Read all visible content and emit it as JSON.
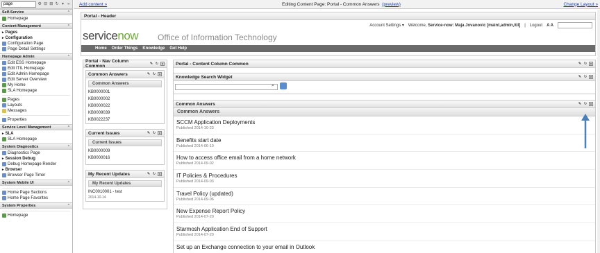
{
  "nav": {
    "search_value": "page",
    "sections": [
      {
        "title": "Self-Service",
        "items": [
          {
            "label": "Homepage",
            "bold": false,
            "color": "#5a9a4a"
          }
        ]
      },
      {
        "title": "Content Management",
        "items": [
          {
            "label": "Pages",
            "bold": true,
            "color": ""
          },
          {
            "label": "Configuration",
            "bold": true,
            "color": ""
          },
          {
            "label": "Configuration Page",
            "bold": false,
            "color": "#6b8ec8"
          },
          {
            "label": "Page Detail Settings",
            "bold": false,
            "color": "#6b8ec8"
          }
        ]
      },
      {
        "title": "Homepage Admin",
        "items": [
          {
            "label": "Edit ESS Homepage",
            "bold": false,
            "color": "#6b8ec8"
          },
          {
            "label": "Edit ITIL Homepage",
            "bold": false,
            "color": "#6b8ec8"
          },
          {
            "label": "Edit Admin Homepage",
            "bold": false,
            "color": "#6b8ec8"
          },
          {
            "label": "Edit Server Overview",
            "bold": false,
            "color": "#6b8ec8"
          },
          {
            "label": "My Home",
            "bold": false,
            "color": "#5a9a4a"
          },
          {
            "label": "SLA Homepage",
            "bold": false,
            "color": "#5a9a4a"
          },
          {
            "label": "",
            "bold": false,
            "color": "gap"
          },
          {
            "label": "Pages",
            "bold": false,
            "color": "#5a9a4a"
          },
          {
            "label": "Layouts",
            "bold": false,
            "color": "#6b8ec8"
          },
          {
            "label": "Messages",
            "bold": false,
            "color": "#d9c445"
          },
          {
            "label": "",
            "bold": false,
            "color": "gap"
          },
          {
            "label": "Properties",
            "bold": false,
            "color": "#6b8ec8"
          }
        ]
      },
      {
        "title": "Service Level Management",
        "items": [
          {
            "label": "SLA",
            "bold": true,
            "color": ""
          },
          {
            "label": "SLA Homepage",
            "bold": false,
            "color": "#5a9a4a"
          }
        ]
      },
      {
        "title": "System Diagnostics",
        "items": [
          {
            "label": "Diagnostics Page",
            "bold": false,
            "color": "#6b8ec8"
          },
          {
            "label": "Session Debug",
            "bold": true,
            "color": ""
          },
          {
            "label": "Debug Homepage Render",
            "bold": false,
            "color": "#6b8ec8"
          },
          {
            "label": "Browser",
            "bold": true,
            "color": ""
          },
          {
            "label": "Browser Page Timer",
            "bold": false,
            "color": "#6b8ec8"
          }
        ]
      },
      {
        "title": "System Mobile UI",
        "items": [
          {
            "label": "",
            "bold": false,
            "color": "gap"
          },
          {
            "label": "Home Page Sections",
            "bold": false,
            "color": "#6b8ec8"
          },
          {
            "label": "Home Page Favorites",
            "bold": false,
            "color": "#6b8ec8"
          }
        ]
      },
      {
        "title": "System Properties",
        "items": [
          {
            "label": "",
            "bold": false,
            "color": "gap"
          },
          {
            "label": "Homepage",
            "bold": false,
            "color": "#5a9a4a"
          }
        ]
      }
    ]
  },
  "topbar": {
    "add_content": "Add content »",
    "editing": "Editing Content Page: Portal - Common Answers",
    "preview": "(preview)",
    "change_layout": "Change Layout »"
  },
  "header": {
    "title": "Portal - Header",
    "account_settings": "Account Settings",
    "welcome_prefix": "Welcome, ",
    "welcome_name": "Service-now: Maja Jovanovic [maint,admin,itil]",
    "logout": "Logout",
    "font_size": "A A",
    "logo_service": "service",
    "logo_now": "now",
    "org_name": "Office of Information Technology",
    "menu": [
      "Home",
      "Order Things",
      "Knowledge",
      "Get Help"
    ]
  },
  "left_col": {
    "title": "Portal - Nav Column Common",
    "widgets": [
      {
        "title": "Common Answers",
        "sub": "Common Answers",
        "items": [
          "KB0000001",
          "KB0000002",
          "KB0000022",
          "KB0009039",
          "KB0022237"
        ]
      },
      {
        "title": "Current Issues",
        "sub": "Current Issues",
        "items": [
          "KB0000009",
          "KB0000016"
        ]
      },
      {
        "title": "My Recent Updates",
        "sub": "My Recent Updates",
        "items": [
          "INC0010001 - test"
        ],
        "date": "2014-10-14"
      }
    ]
  },
  "main_col": {
    "title": "Portal - Content Column Common",
    "kb_search_title": "Knowledge Search Widget",
    "common_answers_title": "Common Answers",
    "common_answers_sub": "Common Answers",
    "articles": [
      {
        "title": "SCCM Application Deployments",
        "published": "Published 2014-10-23"
      },
      {
        "title": "Benefits start date",
        "published": "Published 2014-06-10"
      },
      {
        "title": "How to access office email from a home network",
        "published": "Published 2014-09-02"
      },
      {
        "title": "IT Policies & Procedures",
        "published": "Published 2014-09-03"
      },
      {
        "title": "Travel Policy (updated)",
        "published": "Published 2014-09-06"
      },
      {
        "title": "New Expense Report Policy",
        "published": "Published 2014-07-20"
      },
      {
        "title": "Starmosh Application End of Support",
        "published": "Published 2014-07-20"
      },
      {
        "title": "Set up an Exchange connection to your email in Outlook",
        "published": ""
      }
    ]
  },
  "colors": {
    "brand_green": "#6fa83a",
    "menu_bg": "#6a6a6a",
    "link": "#1a3fb5",
    "arrow": "#4a7fb8"
  }
}
